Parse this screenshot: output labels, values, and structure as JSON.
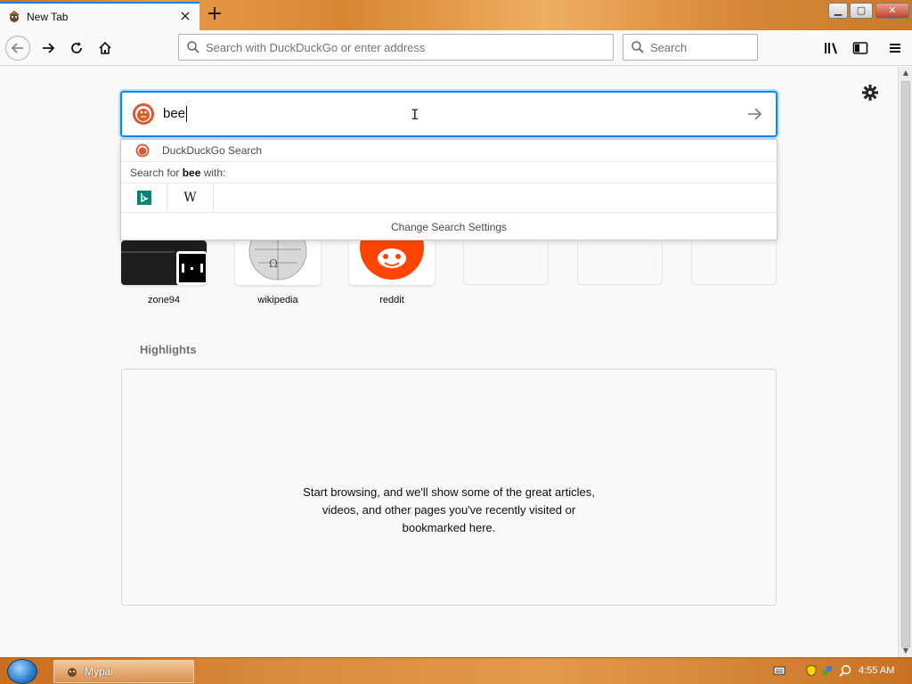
{
  "window": {
    "tab_title": "New Tab",
    "tab_close": "×",
    "new_tab": "+",
    "controls": {
      "minimize": "▁",
      "maximize": "▢",
      "close": "✕"
    }
  },
  "navbar": {
    "url_placeholder": "Search with DuckDuckGo or enter address",
    "search_placeholder": "Search"
  },
  "new_tab_page": {
    "search": {
      "query": "bee",
      "engine_label": "DuckDuckGo Search",
      "search_for_prefix": "Search for ",
      "search_for_term": "bee",
      "search_for_suffix": " with:",
      "one_off_engines": [
        {
          "name": "bing-icon",
          "glyph": "b"
        },
        {
          "name": "wikipedia-icon",
          "glyph": "W"
        }
      ],
      "change_settings": "Change Search Settings"
    },
    "top_sites": [
      {
        "label": "zone94"
      },
      {
        "label": "wikipedia"
      },
      {
        "label": "reddit"
      },
      {
        "label": ""
      },
      {
        "label": ""
      },
      {
        "label": ""
      }
    ],
    "highlights": {
      "title": "Highlights",
      "empty_message": "Start browsing, and we'll show some of the great articles, videos, and other pages you've recently visited or bookmarked here."
    }
  },
  "taskbar": {
    "task_label": "Mypal",
    "clock": "4:55 AM"
  },
  "colors": {
    "accent": "#0a84ff",
    "reddit": "#ff4500",
    "ddg": "#de5833",
    "bing": "#008373"
  }
}
